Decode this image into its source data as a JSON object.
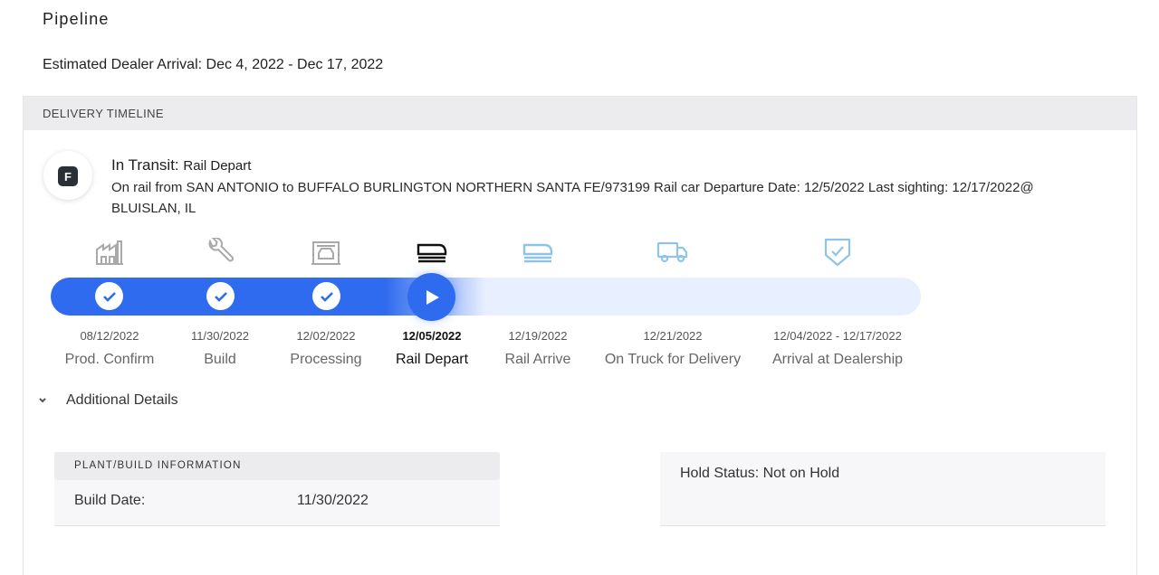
{
  "page": {
    "title": "Pipeline",
    "estimate": "Estimated Dealer Arrival: Dec 4, 2022 - Dec 17, 2022"
  },
  "timeline": {
    "header": "DELIVERY TIMELINE",
    "avatar_letter": "F",
    "status_prefix": "In Transit:",
    "status_value": "Rail Depart",
    "description": "On rail from SAN ANTONIO to BUFFALO BURLINGTON NORTHERN SANTA FE/973199 Rail car Departure Date: 12/5/2022 Last sighting: 12/17/2022@ BLUISLAN, IL",
    "steps": [
      {
        "label": "Prod. Confirm",
        "date": "08/12/2022",
        "icon": "factory-icon",
        "state": "complete"
      },
      {
        "label": "Build",
        "date": "11/30/2022",
        "icon": "wrench-icon",
        "state": "complete"
      },
      {
        "label": "Processing",
        "date": "12/02/2022",
        "icon": "car-wash-icon",
        "state": "complete"
      },
      {
        "label": "Rail Depart",
        "date": "12/05/2022",
        "icon": "train-icon",
        "state": "current"
      },
      {
        "label": "Rail Arrive",
        "date": "12/19/2022",
        "icon": "train-icon",
        "state": "upcoming"
      },
      {
        "label": "On Truck for Delivery",
        "date": "12/21/2022",
        "icon": "truck-icon",
        "state": "upcoming"
      },
      {
        "label": "Arrival at Dealership",
        "date": "12/04/2022 - 12/17/2022",
        "icon": "shield-check-icon",
        "state": "upcoming"
      }
    ]
  },
  "details": {
    "toggle_label": "Additional Details",
    "plant": {
      "header": "PLANT/BUILD INFORMATION",
      "build_date_label": "Build Date:",
      "build_date_value": "11/30/2022"
    },
    "hold_status": "Hold Status: Not on Hold"
  },
  "colors": {
    "accent": "#2f6bef",
    "track_light": "#e8efff",
    "icon_done": "#a9a9a9",
    "icon_current": "#111111",
    "icon_upcoming": "#8fc3e8"
  }
}
